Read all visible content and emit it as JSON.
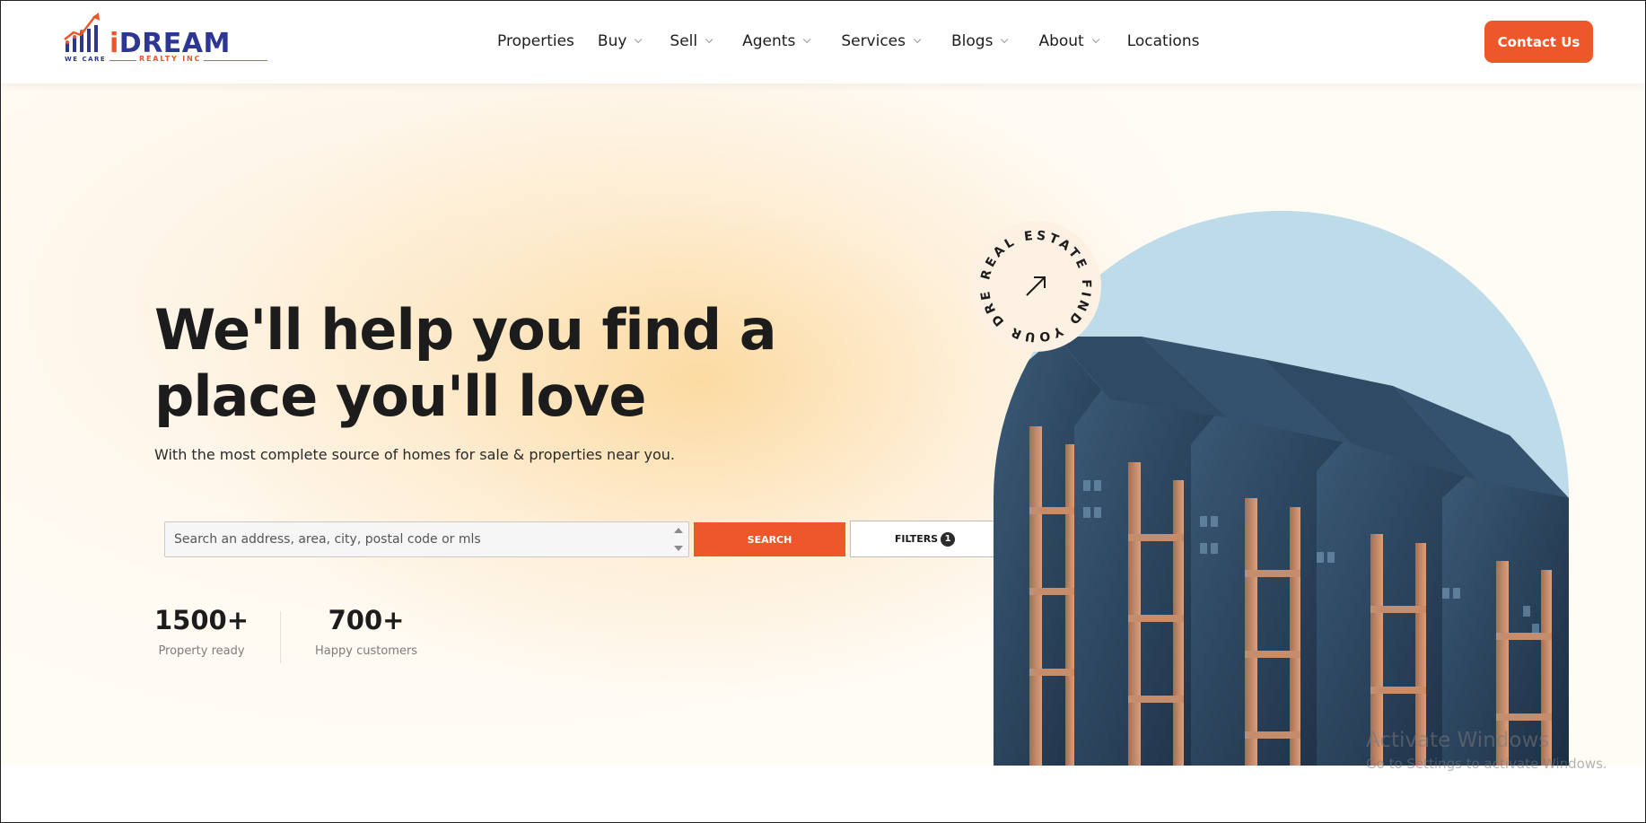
{
  "brand": {
    "logo_letter": "i",
    "logo_word": "DREAM",
    "tagline": "WE CARE",
    "subtitle": "REALTY INC",
    "colors": {
      "accent": "#ee5729",
      "navy": "#2d3693"
    }
  },
  "nav": {
    "items": [
      {
        "label": "Properties",
        "dropdown": false
      },
      {
        "label": "Buy",
        "dropdown": true
      },
      {
        "label": "Sell",
        "dropdown": true
      },
      {
        "label": "Agents",
        "dropdown": true
      },
      {
        "label": "Services",
        "dropdown": true
      },
      {
        "label": "Blogs",
        "dropdown": true
      },
      {
        "label": "About",
        "dropdown": true
      },
      {
        "label": "Locations",
        "dropdown": false
      }
    ],
    "contact_label": "Contact Us"
  },
  "hero": {
    "title_line1": "We'll help you find a",
    "title_line2": "place you'll love",
    "subtitle": "With the most complete source of homes for sale & properties near you.",
    "search": {
      "placeholder": "Search an address, area, city, postal code or mls",
      "value": "",
      "button_label": "SEARCH",
      "filters_label": "FILTERS",
      "filters_count": "1"
    },
    "stats": [
      {
        "value": "1500+",
        "label": "Property ready"
      },
      {
        "value": "700+",
        "label": "Happy customers"
      }
    ],
    "badge_text": "REAL ESTATE  FIND YOUR DREAMS",
    "badge_icon": "arrow-up-right-icon"
  },
  "watermark": {
    "title": "Activate Windows",
    "subtitle": "Go to Settings to activate Windows."
  }
}
